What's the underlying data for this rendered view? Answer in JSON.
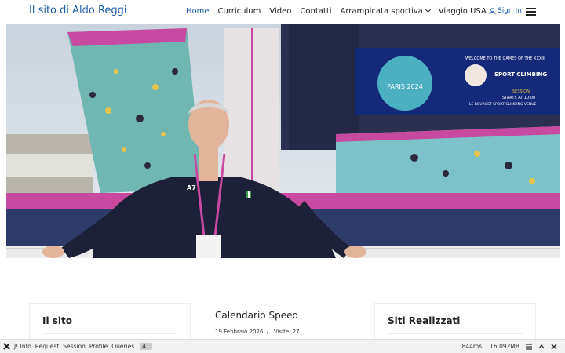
{
  "header": {
    "brand": "Il sito di Aldo Reggi",
    "nav": [
      {
        "label": "Home",
        "active": true
      },
      {
        "label": "Curriculum"
      },
      {
        "label": "Video"
      },
      {
        "label": "Contatti"
      },
      {
        "label": "Arrampicata sportiva",
        "dropdown": true
      },
      {
        "label": "Viaggio USA"
      }
    ],
    "signin": "Sign In",
    "menu_icon": "hamburger-icon"
  },
  "hero": {
    "screen_line1": "WELCOME TO THE GAMES OF THE XXXIII",
    "screen_title": "SPORT CLIMBING",
    "screen_session": "SESSION",
    "screen_starts": "STARTS AT 10:00",
    "screen_venue": "LE BOURGET SPORT CLIMBING VENUE",
    "logo_text": "PARIS 2024",
    "jacket_brand": "A7"
  },
  "cards": {
    "site": {
      "title": "Il sito"
    },
    "calendar": {
      "title": "Calendario Speed",
      "date": "19 Febbraio 2026",
      "sep": "/",
      "visits": "Visite: 27"
    },
    "sites": {
      "title": "Siti Realizzati"
    }
  },
  "debugbar": {
    "items": [
      "J! Info",
      "Request",
      "Session",
      "Profile",
      "Queries"
    ],
    "queries_count": "41",
    "time": "844ms",
    "memory": "16.092MB"
  },
  "colors": {
    "brand": "#1f5fa6",
    "accent": "#1f5fa6"
  }
}
